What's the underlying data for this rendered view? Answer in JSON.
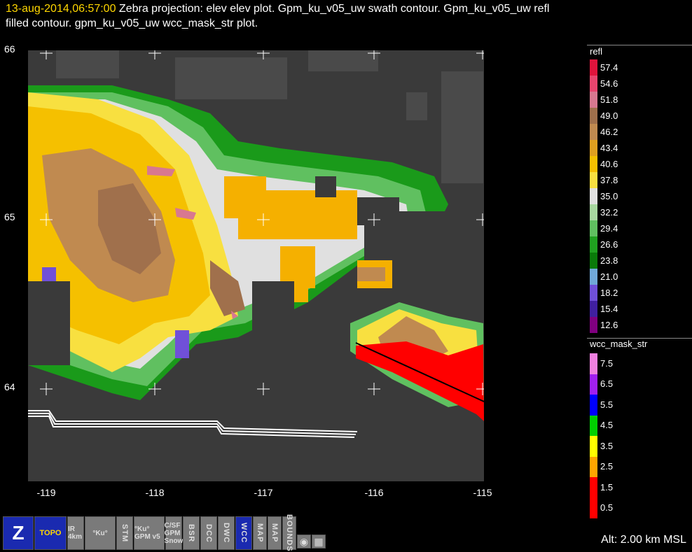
{
  "header": {
    "timestamp": "13-aug-2014,06:57:00",
    "line1_rest": "  Zebra projection: elev elev  plot.  Gpm_ku_v05_uw swath contour.  Gpm_ku_v05_uw refl",
    "line2": "filled contour.  gpm_ku_v05_uw wcc_mask_str  plot."
  },
  "axes": {
    "y_labels": [
      "66",
      "65",
      "64"
    ],
    "x_labels": [
      "-119",
      "-118",
      "-117",
      "-116",
      "-115"
    ]
  },
  "legend_refl": {
    "title": "refl",
    "items": [
      {
        "label": "57.4",
        "color": "#e0143c"
      },
      {
        "label": "54.6",
        "color": "#e8456e"
      },
      {
        "label": "51.8",
        "color": "#d87890"
      },
      {
        "label": "49.0",
        "color": "#a0704c"
      },
      {
        "label": "46.2",
        "color": "#c08a50"
      },
      {
        "label": "43.4",
        "color": "#e0a020"
      },
      {
        "label": "40.6",
        "color": "#f5c000"
      },
      {
        "label": "37.8",
        "color": "#f8e040"
      },
      {
        "label": "35.0",
        "color": "#e0e0e0"
      },
      {
        "label": "32.2",
        "color": "#a8d8a0"
      },
      {
        "label": "29.4",
        "color": "#60c060"
      },
      {
        "label": "26.6",
        "color": "#20a020"
      },
      {
        "label": "23.8",
        "color": "#0a7a0a"
      },
      {
        "label": "21.0",
        "color": "#70a8d8"
      },
      {
        "label": "18.2",
        "color": "#7050d8"
      },
      {
        "label": "15.4",
        "color": "#4020a0"
      },
      {
        "label": "12.6",
        "color": "#800080"
      }
    ]
  },
  "legend_wcc": {
    "title": "wcc_mask_str",
    "items": [
      {
        "label": "7.5",
        "color": "#f080e0"
      },
      {
        "label": "6.5",
        "color": "#a020f0"
      },
      {
        "label": "5.5",
        "color": "#0000ff"
      },
      {
        "label": "4.5",
        "color": "#00d000"
      },
      {
        "label": "3.5",
        "color": "#ffff00"
      },
      {
        "label": "2.5",
        "color": "#ffa500"
      },
      {
        "label": "1.5",
        "color": "#ff0000"
      },
      {
        "label": "0.5",
        "color": "#ff0000"
      }
    ]
  },
  "toolbar": {
    "items": [
      {
        "name": "zebra-logo-icon",
        "label": "Z"
      },
      {
        "name": "topo-button",
        "label": "TOPO"
      },
      {
        "name": "ir-button",
        "label": "IR 4km"
      },
      {
        "name": "ku-button",
        "label": "°Ku°"
      },
      {
        "name": "stm-button",
        "label": "STM"
      },
      {
        "name": "ku-v5-button",
        "label": "°Ku° GPM v5"
      },
      {
        "name": "sf-gpm-button",
        "label": "C/SF GPM Snow"
      },
      {
        "name": "bsr-button",
        "label": "BSR"
      },
      {
        "name": "dcc-button",
        "label": "DCC"
      },
      {
        "name": "dwc-button",
        "label": "DWC"
      },
      {
        "name": "wcc-button",
        "label": "WCC"
      },
      {
        "name": "map-button",
        "label": "MAP"
      },
      {
        "name": "map2-button",
        "label": "MAP"
      },
      {
        "name": "bounds-button",
        "label": "BOUNDS"
      },
      {
        "name": "target-button",
        "label": "◉"
      },
      {
        "name": "grid-button",
        "label": "▦"
      }
    ]
  },
  "status": {
    "altitude": "Alt: 2.00 km MSL"
  }
}
